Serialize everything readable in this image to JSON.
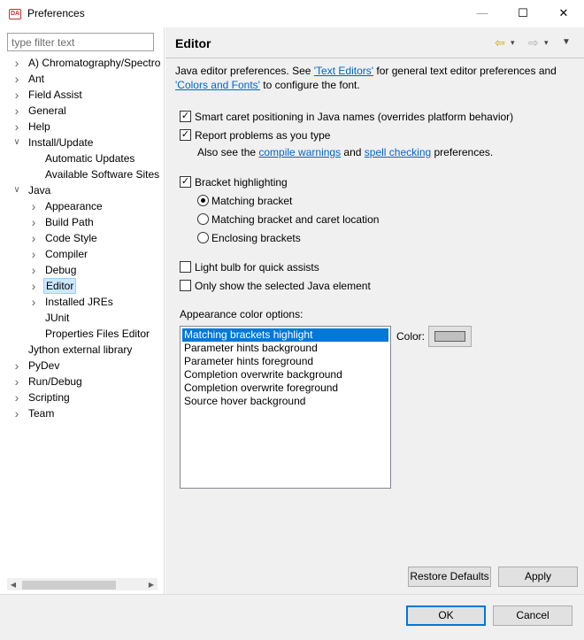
{
  "window": {
    "title": "Preferences",
    "icon_text": "ℹ",
    "min": "—",
    "max": "☐",
    "close": "✕"
  },
  "filter": {
    "placeholder": "type filter text"
  },
  "tree": {
    "items": [
      {
        "label": "A) Chromatography/Spectro",
        "level": 0,
        "arrow": ">"
      },
      {
        "label": "Ant",
        "level": 0,
        "arrow": ">"
      },
      {
        "label": "Field Assist",
        "level": 0,
        "arrow": ">"
      },
      {
        "label": "General",
        "level": 0,
        "arrow": ">"
      },
      {
        "label": "Help",
        "level": 0,
        "arrow": ">"
      },
      {
        "label": "Install/Update",
        "level": 0,
        "arrow": "v"
      },
      {
        "label": "Automatic Updates",
        "level": 1,
        "arrow": ""
      },
      {
        "label": "Available Software Sites",
        "level": 1,
        "arrow": ""
      },
      {
        "label": "Java",
        "level": 0,
        "arrow": "v"
      },
      {
        "label": "Appearance",
        "level": 1,
        "arrow": ">"
      },
      {
        "label": "Build Path",
        "level": 1,
        "arrow": ">"
      },
      {
        "label": "Code Style",
        "level": 1,
        "arrow": ">"
      },
      {
        "label": "Compiler",
        "level": 1,
        "arrow": ">"
      },
      {
        "label": "Debug",
        "level": 1,
        "arrow": ">"
      },
      {
        "label": "Editor",
        "level": 1,
        "arrow": ">",
        "selected": true
      },
      {
        "label": "Installed JREs",
        "level": 1,
        "arrow": ">"
      },
      {
        "label": "JUnit",
        "level": 1,
        "arrow": ""
      },
      {
        "label": "Properties Files Editor",
        "level": 1,
        "arrow": ""
      },
      {
        "label": "Jython external library",
        "level": 0,
        "arrow": ""
      },
      {
        "label": "PyDev",
        "level": 0,
        "arrow": ">"
      },
      {
        "label": "Run/Debug",
        "level": 0,
        "arrow": ">"
      },
      {
        "label": "Scripting",
        "level": 0,
        "arrow": ">"
      },
      {
        "label": "Team",
        "level": 0,
        "arrow": ">"
      }
    ]
  },
  "editor": {
    "title": "Editor",
    "nav": {
      "back": "⇦",
      "back_menu": "▾",
      "forward": "⇨",
      "forward_menu": "▾",
      "view_menu": "▼"
    },
    "desc": {
      "p1": "Java editor preferences. See ",
      "link1": "'Text Editors'",
      "p2": " for general text editor preferences and ",
      "link2": "'Colors and Fonts'",
      "p3": " to configure the font."
    },
    "smart_caret": {
      "label": "Smart caret positioning in Java names (overrides platform behavior)",
      "checked": true
    },
    "report_problems": {
      "label": "Report problems as you type",
      "checked": true
    },
    "also": {
      "p1": "Also see the ",
      "link1": "compile warnings",
      "p2": " and ",
      "link2": "spell checking",
      "p3": " preferences."
    },
    "bracket": {
      "label": "Bracket highlighting",
      "checked": true
    },
    "radios": [
      {
        "label": "Matching bracket",
        "selected": true
      },
      {
        "label": "Matching bracket and caret location",
        "selected": false
      },
      {
        "label": "Enclosing brackets",
        "selected": false
      }
    ],
    "light_bulb": {
      "label": "Light bulb for quick assists",
      "checked": false
    },
    "only_selected": {
      "label": "Only show the selected Java element",
      "checked": false
    },
    "appearance_label": "Appearance color options:",
    "color_options": [
      "Matching brackets highlight",
      "Parameter hints background",
      "Parameter hints foreground",
      "Completion overwrite background",
      "Completion overwrite foreground",
      "Source hover background"
    ],
    "selected_color_option": 0,
    "color_label": "Color:",
    "color_swatch": "#c0c0c0",
    "restore_defaults": "Restore Defaults",
    "apply": "Apply"
  },
  "dialog": {
    "ok": "OK",
    "cancel": "Cancel"
  },
  "colors": {
    "selection": "#0078d7",
    "link": "#0066cc",
    "tree_selection": "#cde8ff"
  }
}
